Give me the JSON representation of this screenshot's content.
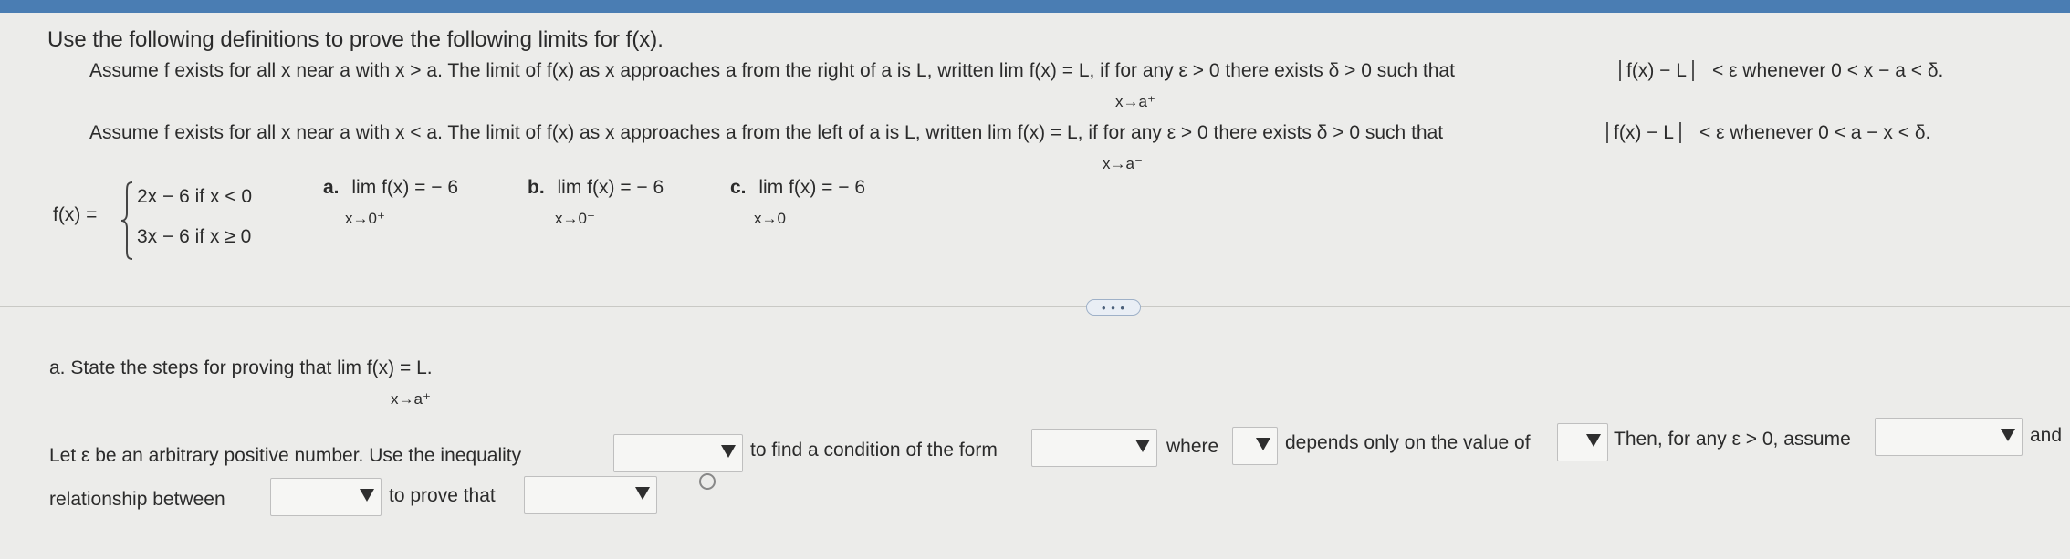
{
  "header": {
    "instruction": "Use the following definitions to prove the following limits for f(x)."
  },
  "definitions": {
    "right": {
      "part1": "Assume f exists for all x near a with x > a. The limit of f(x) as x approaches a from the right of a is L, written  lim  f(x) = L, if for any ε > 0 there exists δ > 0  such that",
      "abs_text": "f(x) − L",
      "part2": "< ε whenever 0 < x − a < δ.",
      "limit_sub": "x→a⁺"
    },
    "left": {
      "part1": "Assume f exists for all x near a with x < a. The limit of f(x) as x approaches a from the left of a is L, written  lim  f(x) = L, if for any ε > 0 there exists δ > 0 such that",
      "abs_text": "f(x) − L",
      "part2": "< ε whenever 0 < a − x < δ.",
      "limit_sub": "x→a⁻"
    }
  },
  "function": {
    "lhs": "f(x) =",
    "case1": "2x − 6  if x < 0",
    "case2": "3x − 6  if x ≥ 0"
  },
  "problems": [
    {
      "letter": "a.",
      "expr": "lim  f(x) = − 6",
      "sub": "x→0⁺"
    },
    {
      "letter": "b.",
      "expr": "lim  f(x) = − 6",
      "sub": "x→0⁻"
    },
    {
      "letter": "c.",
      "expr": "lim  f(x) = − 6",
      "sub": "x→0"
    }
  ],
  "ellipsis": "• • •",
  "part_a": {
    "prompt": "a. State the steps for proving that  lim  f(x) = L.",
    "sub": "x→a⁺"
  },
  "answer": {
    "t1": "Let ε be an arbitrary positive number. Use the inequality",
    "t2": "to find a condition of the form",
    "t3": "where",
    "t4": "depends only on the value of",
    "t5": "Then, for any ε > 0, assume",
    "t6": "and",
    "t7": "relationship between",
    "t8": "to prove that"
  },
  "dropdowns": {
    "inequality": "",
    "condition_form": "",
    "where": "",
    "depends_on": "",
    "assume": "",
    "relationship": "",
    "prove": ""
  }
}
